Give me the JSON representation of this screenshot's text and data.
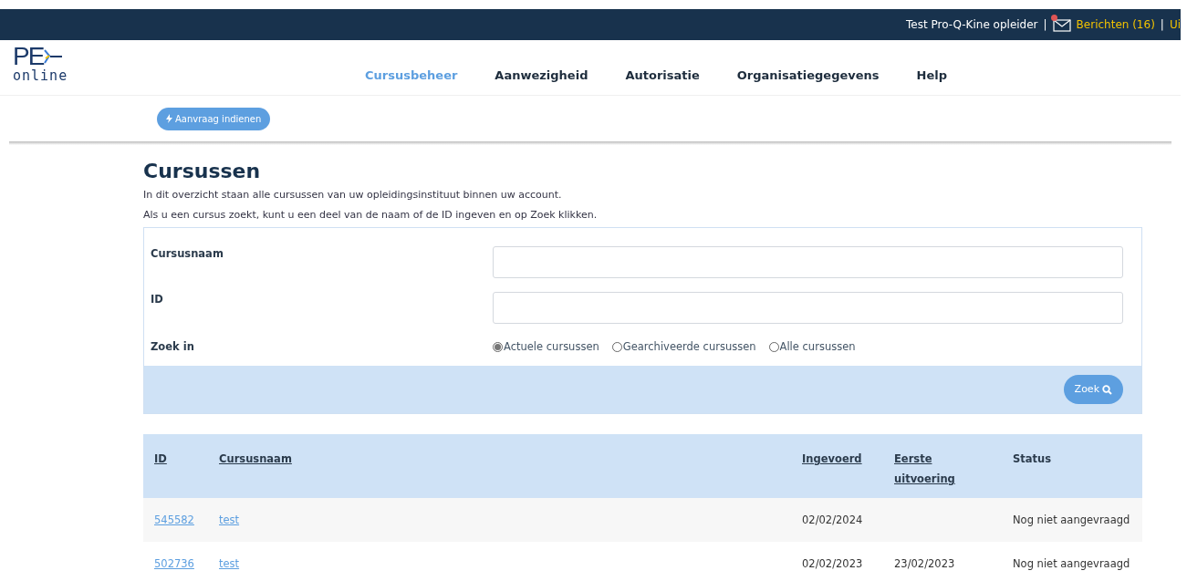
{
  "top_bar": {
    "user": "Test Pro-Q-Kine opleider",
    "separator_1": "|",
    "messages": "Berichten (16)",
    "messages_unread": true,
    "separator_2": "|",
    "logout": "Ui"
  },
  "logo": {
    "letters": "PE",
    "word": "online"
  },
  "nav": [
    {
      "label": "Cursusbeheer",
      "selected": true
    },
    {
      "label": "Aanwezigheid",
      "selected": false
    },
    {
      "label": "Autorisatie",
      "selected": false
    },
    {
      "label": "Organisatiegegevens",
      "selected": false
    },
    {
      "label": "Help",
      "selected": false
    }
  ],
  "request_button": "Aanvraag indienen",
  "page_title": "Cursussen",
  "intro": [
    "In dit overzicht staan alle cursussen van uw opleidingsinstituut binnen uw account.",
    "Als u een cursus zoekt, kunt u een deel van de naam of de ID ingeven en op Zoek klikken."
  ],
  "search": {
    "name_label": "Cursusnaam",
    "id_label": "ID",
    "scope_label": "Zoek in",
    "scopes": [
      {
        "label": "Actuele cursussen",
        "selected": true
      },
      {
        "label": "Gearchiveerde cursussen",
        "selected": false
      },
      {
        "label": "Alle cursussen",
        "selected": false
      }
    ],
    "button": "Zoek"
  },
  "table": {
    "columns": [
      {
        "label": "ID",
        "sortable": true
      },
      {
        "label": "Cursusnaam",
        "sortable": true
      },
      {
        "label": "Ingevoerd",
        "sortable": true
      },
      {
        "label": "Eerste uitvoering",
        "sortable": true
      },
      {
        "label": "Status",
        "sortable": false
      }
    ],
    "rows": [
      [
        "545582",
        "test",
        "02/02/2024",
        "",
        "Nog niet aangevraagd"
      ],
      [
        "502736",
        "test",
        "02/02/2023",
        "23/02/2023",
        "Nog niet aangevraagd"
      ]
    ]
  }
}
